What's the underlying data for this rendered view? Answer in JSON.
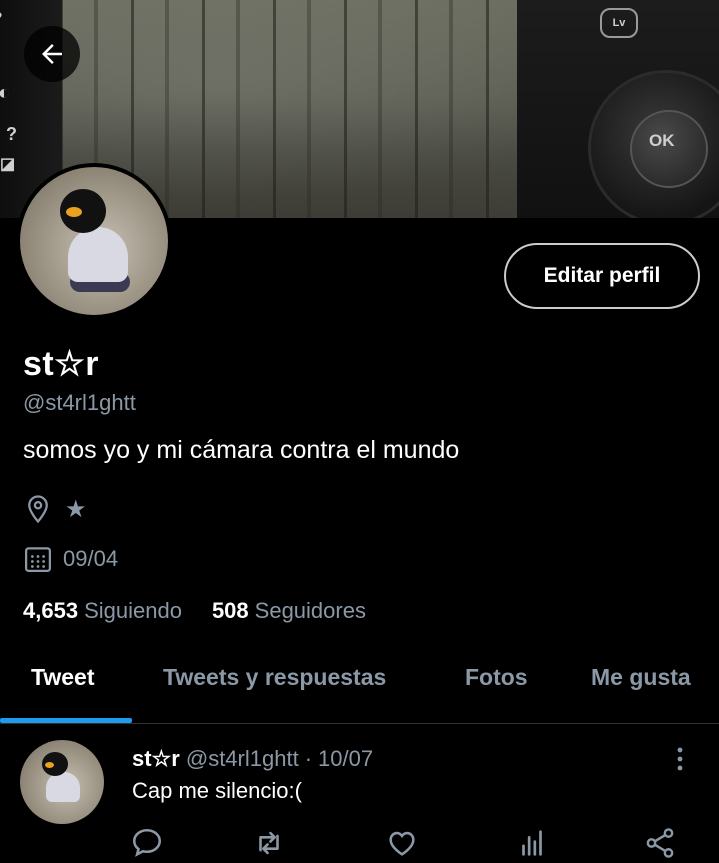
{
  "banner": {
    "ok_text": "OK",
    "lv_text": "Lv"
  },
  "profile": {
    "edit_button": "Editar perfil",
    "name": "st☆r",
    "handle": "@st4rl1ghtt",
    "bio": "somos yo y mi cámara contra el mundo",
    "location": "★",
    "date": "09/04",
    "following_count": "4,653",
    "following_label": "Siguiendo",
    "followers_count": "508",
    "followers_label": "Seguidores"
  },
  "tabs": [
    {
      "label": "Tweet",
      "active": true
    },
    {
      "label": "Tweets y respuestas",
      "active": false
    },
    {
      "label": "Fotos",
      "active": false
    },
    {
      "label": "Me gusta",
      "active": false
    }
  ],
  "tweet": {
    "name": "st☆r",
    "handle": "@st4rl1ghtt",
    "separator": "·",
    "date": "10/07",
    "text": "Cap me silencio:("
  },
  "colors": {
    "accent": "#1d9bf0",
    "muted": "#8b98a5",
    "background": "#000000"
  },
  "icons": [
    "back-arrow-icon",
    "location-pin-icon",
    "calendar-icon",
    "more-vertical-icon",
    "reply-icon",
    "retweet-icon",
    "like-icon",
    "analytics-icon",
    "share-icon"
  ]
}
